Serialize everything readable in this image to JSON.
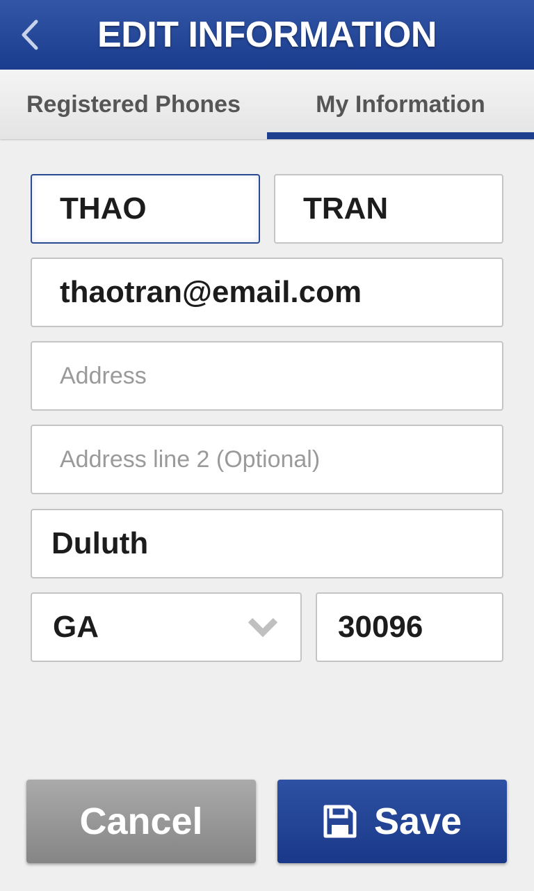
{
  "header": {
    "title": "EDIT INFORMATION",
    "back_icon": "chevron-left-icon"
  },
  "tabs": [
    {
      "label": "Registered Phones",
      "active": false
    },
    {
      "label": "My Information",
      "active": true
    }
  ],
  "form": {
    "first_name": {
      "value": "THAO"
    },
    "last_name": {
      "value": "TRAN"
    },
    "email": {
      "value": "thaotran@email.com"
    },
    "address": {
      "value": "",
      "placeholder": "Address"
    },
    "address2": {
      "value": "",
      "placeholder": "Address line 2 (Optional)"
    },
    "city": {
      "value": "Duluth"
    },
    "state": {
      "value": "GA"
    },
    "zip": {
      "value": "30096"
    }
  },
  "buttons": {
    "cancel_label": "Cancel",
    "save_label": "Save"
  },
  "colors": {
    "brand": "#1e3f8e",
    "cancel": "#999999",
    "background": "#efefef"
  }
}
